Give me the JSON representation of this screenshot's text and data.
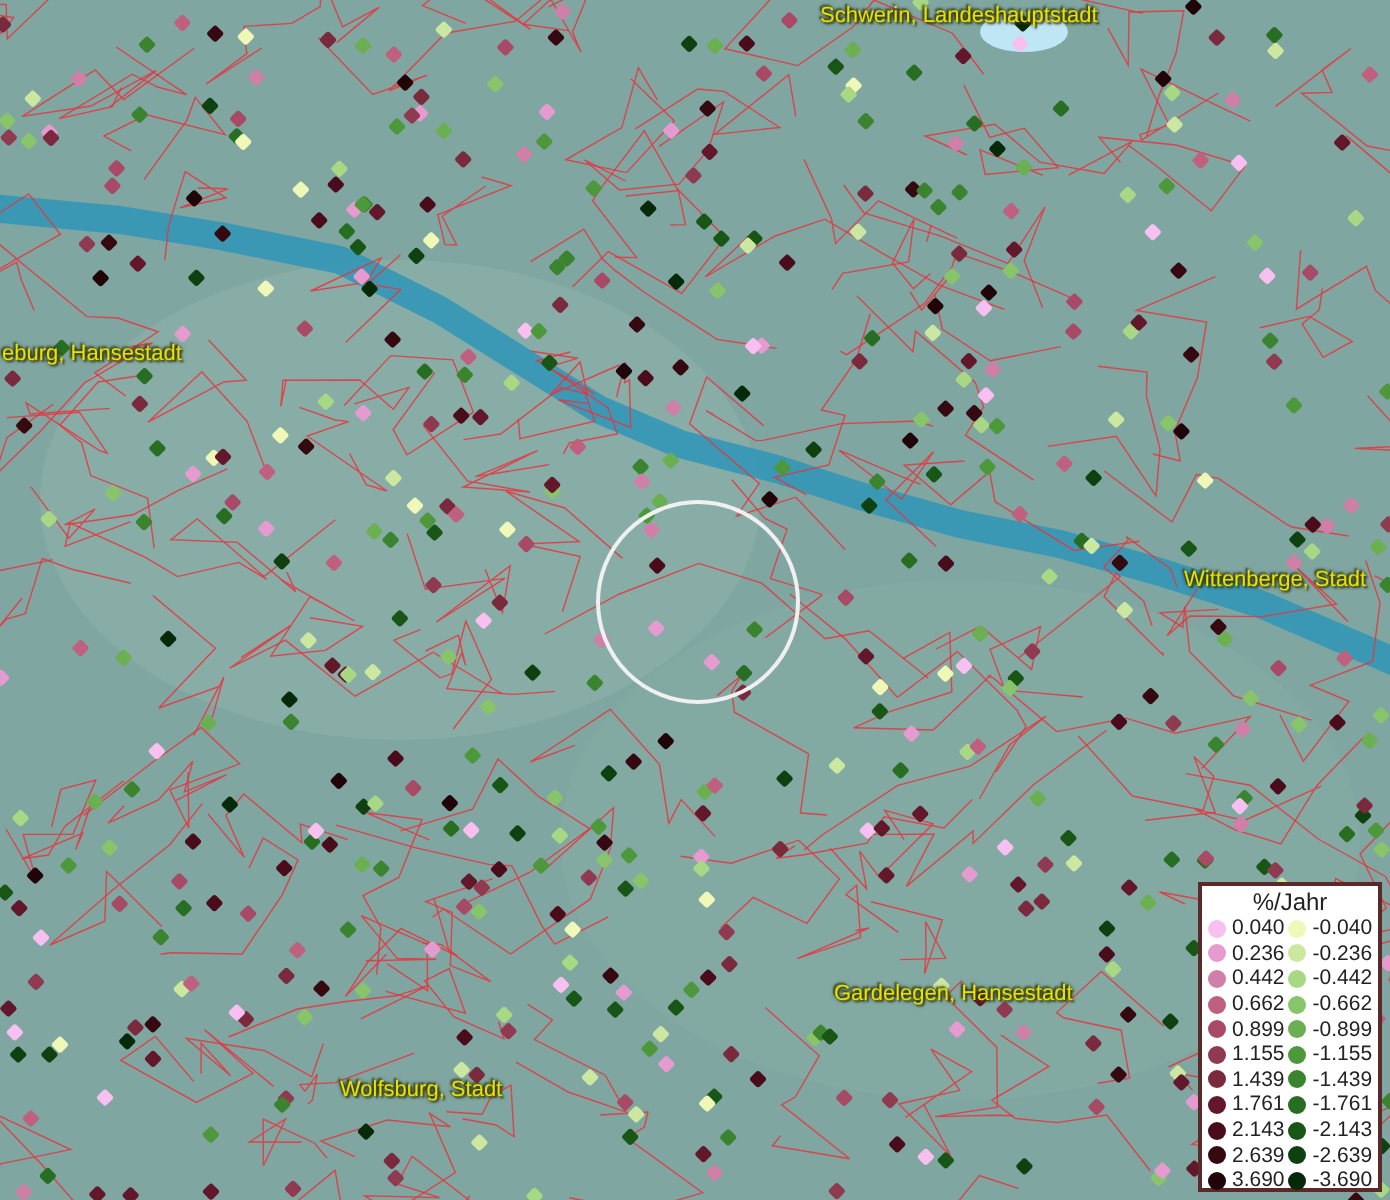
{
  "map": {
    "place_labels": [
      {
        "text": "Schwerin, Landeshauptstadt"
      },
      {
        "text": "eburg, Hansestadt"
      },
      {
        "text": "Wittenberge, Stadt"
      },
      {
        "text": "Gardelegen, Hansestadt"
      },
      {
        "text": "Wolfsburg, Stadt"
      }
    ]
  },
  "legend": {
    "title": "%/Jahr",
    "rows": [
      {
        "positive": {
          "value": "0.040",
          "color": "#f7c0f0"
        },
        "negative": {
          "value": "-0.040",
          "color": "#f0f8b8"
        }
      },
      {
        "positive": {
          "value": "0.236",
          "color": "#e59ad0"
        },
        "negative": {
          "value": "-0.236",
          "color": "#cce8a0"
        }
      },
      {
        "positive": {
          "value": "0.442",
          "color": "#d07fa8"
        },
        "negative": {
          "value": "-0.442",
          "color": "#a8d884"
        }
      },
      {
        "positive": {
          "value": "0.662",
          "color": "#c0607f"
        },
        "negative": {
          "value": "-0.662",
          "color": "#88c46a"
        }
      },
      {
        "positive": {
          "value": "0.899",
          "color": "#a84a66"
        },
        "negative": {
          "value": "-0.899",
          "color": "#6ab050"
        }
      },
      {
        "positive": {
          "value": "1.155",
          "color": "#8f3a50"
        },
        "negative": {
          "value": "-1.155",
          "color": "#4c983a"
        }
      },
      {
        "positive": {
          "value": "1.439",
          "color": "#7a2a3c"
        },
        "negative": {
          "value": "-1.439",
          "color": "#3a8430"
        }
      },
      {
        "positive": {
          "value": "1.761",
          "color": "#62182a"
        },
        "negative": {
          "value": "-1.761",
          "color": "#286e22"
        }
      },
      {
        "positive": {
          "value": "2.143",
          "color": "#4a0c1a"
        },
        "negative": {
          "value": "-2.143",
          "color": "#185616"
        }
      },
      {
        "positive": {
          "value": "2.639",
          "color": "#360810"
        },
        "negative": {
          "value": "-2.639",
          "color": "#0e4010"
        }
      },
      {
        "positive": {
          "value": "3.690",
          "color": "#200408"
        },
        "negative": {
          "value": "-3.690",
          "color": "#062a08"
        }
      }
    ]
  }
}
